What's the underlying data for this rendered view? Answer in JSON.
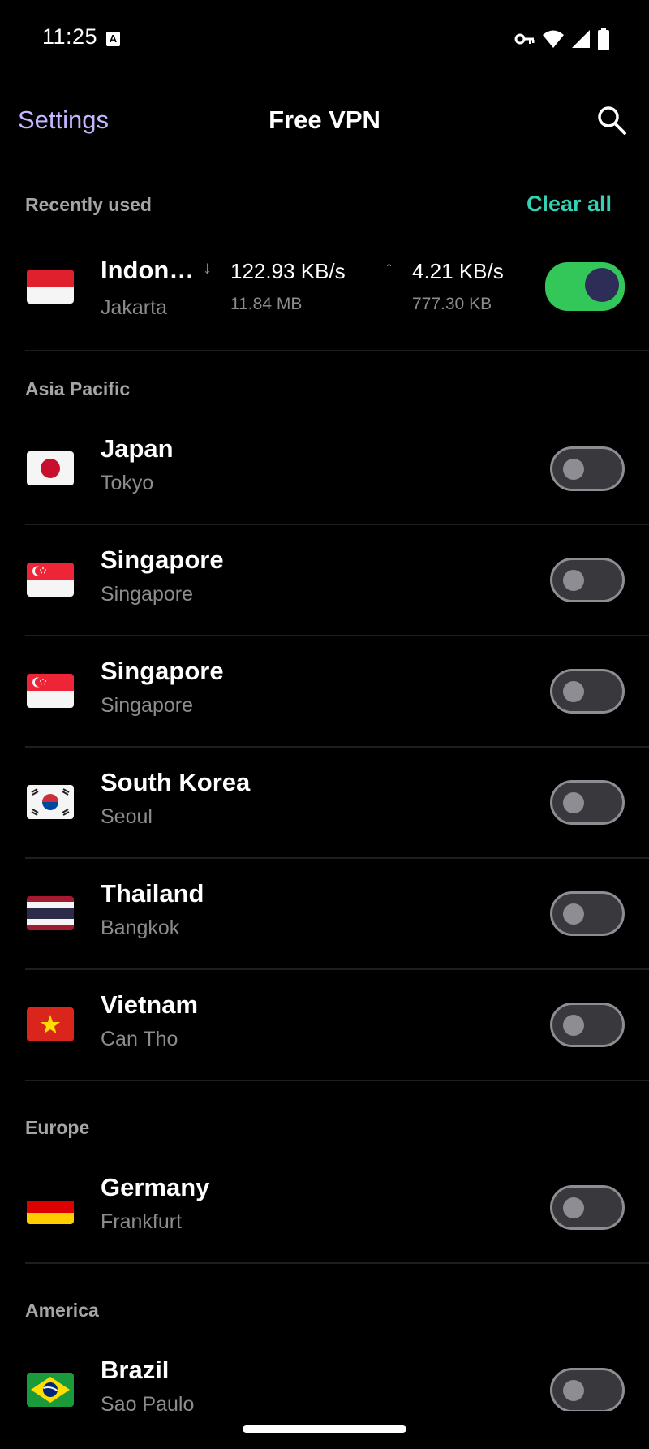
{
  "status_bar": {
    "time": "11:25",
    "icons": [
      "keyboard-a-icon",
      "vpn-key-icon",
      "wifi-icon",
      "signal-icon",
      "battery-icon"
    ]
  },
  "app_bar": {
    "back_label": "Settings",
    "title": "Free VPN",
    "search_icon": "search-icon"
  },
  "recent": {
    "header": "Recently used",
    "clear_all": "Clear all",
    "item": {
      "country": "Indon…",
      "city": "Jakarta",
      "download_rate": "122.93 KB/s",
      "download_total": "11.84 MB",
      "upload_rate": "4.21 KB/s",
      "upload_total": "777.30 KB",
      "connected": true
    }
  },
  "sections": [
    {
      "header": "Asia Pacific",
      "items": [
        {
          "country": "Japan",
          "city": "Tokyo",
          "flag": "japan"
        },
        {
          "country": "Singapore",
          "city": "Singapore",
          "flag": "singapore"
        },
        {
          "country": "Singapore",
          "city": "Singapore",
          "flag": "singapore"
        },
        {
          "country": "South Korea",
          "city": "Seoul",
          "flag": "south-korea"
        },
        {
          "country": "Thailand",
          "city": "Bangkok",
          "flag": "thailand"
        },
        {
          "country": "Vietnam",
          "city": "Can Tho",
          "flag": "vietnam"
        }
      ]
    },
    {
      "header": "Europe",
      "items": [
        {
          "country": "Germany",
          "city": "Frankfurt",
          "flag": "germany"
        }
      ]
    },
    {
      "header": "America",
      "items": [
        {
          "country": "Brazil",
          "city": "Sao Paulo",
          "flag": "brazil"
        }
      ]
    }
  ],
  "colors": {
    "accent_settings": "#c5b6ff",
    "accent_clear": "#35d1b5",
    "toggle_on": "#33c75a",
    "background": "#000000"
  }
}
